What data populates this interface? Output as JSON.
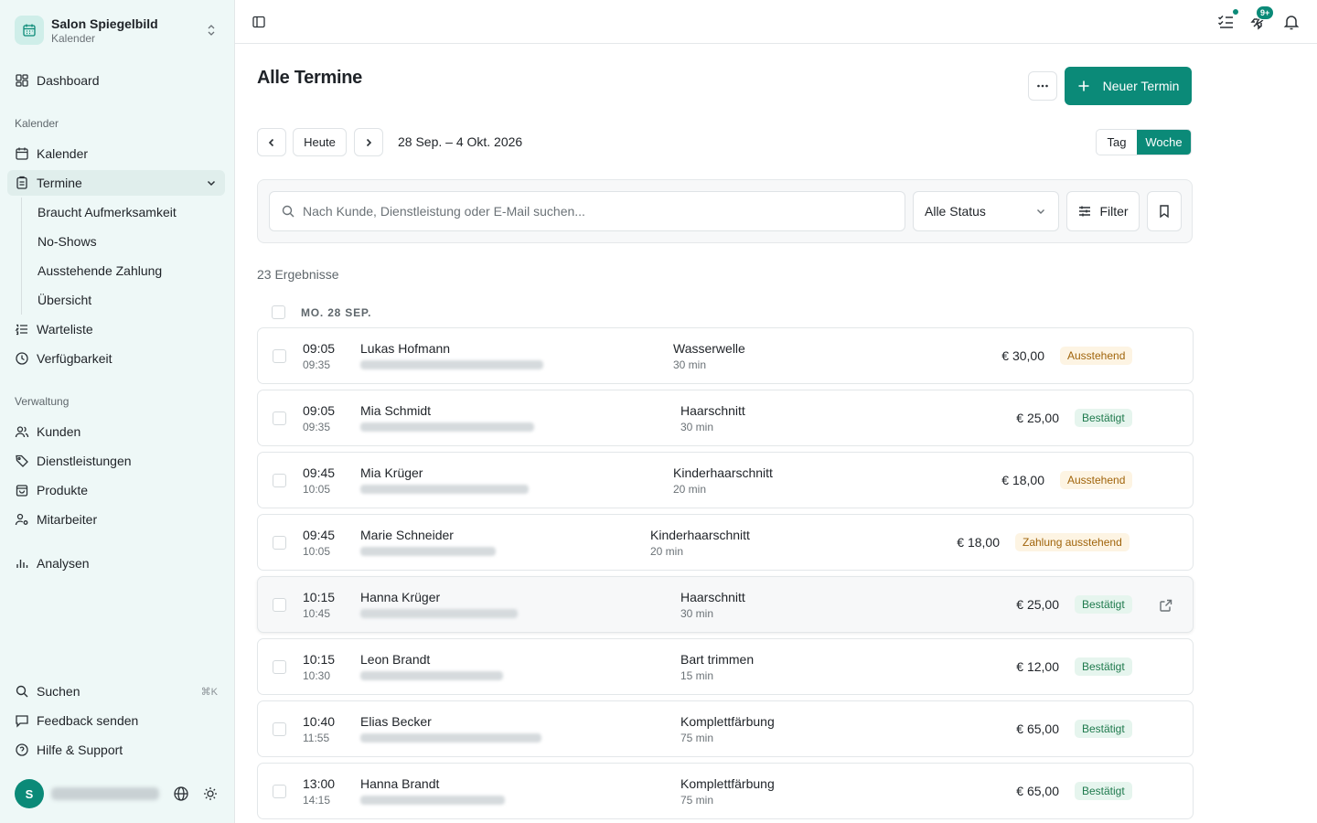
{
  "workspace": {
    "name": "Salon Spiegelbild",
    "sub": "Kalender"
  },
  "nav": {
    "dashboard": "Dashboard",
    "group_calendar": "Kalender",
    "kalender": "Kalender",
    "termine": "Termine",
    "sub": [
      "Braucht Aufmerksamkeit",
      "No-Shows",
      "Ausstehende Zahlung",
      "Übersicht"
    ],
    "warteliste": "Warteliste",
    "verfuegbarkeit": "Verfügbarkeit",
    "group_admin": "Verwaltung",
    "kunden": "Kunden",
    "dienstleistungen": "Dienstleistungen",
    "produkte": "Produkte",
    "mitarbeiter": "Mitarbeiter",
    "analysen": "Analysen",
    "suchen": "Suchen",
    "suchen_kbd": "⌘K",
    "feedback": "Feedback senden",
    "hilfe": "Hilfe & Support"
  },
  "user": {
    "initial": "S"
  },
  "topbar": {
    "badge": "9+"
  },
  "page": {
    "title": "Alle Termine",
    "new_button": "Neuer Termin",
    "today": "Heute",
    "range": "28 Sep. – 4 Okt. 2026",
    "view_day": "Tag",
    "view_week": "Woche",
    "search_placeholder": "Nach Kunde, Dienstleistung oder E-Mail suchen...",
    "status_select": "Alle Status",
    "filter": "Filter",
    "results": "23 Ergebnisse",
    "day_label": "MO. 28 SEP."
  },
  "appointments": [
    {
      "start": "09:05",
      "end": "09:35",
      "customer": "Lukas Hofmann",
      "service": "Wasserwelle",
      "duration": "30 min",
      "price": "€ 30,00",
      "status": "Ausstehend",
      "status_type": "pending"
    },
    {
      "start": "09:05",
      "end": "09:35",
      "customer": "Mia Schmidt",
      "service": "Haarschnitt",
      "duration": "30 min",
      "price": "€ 25,00",
      "status": "Bestätigt",
      "status_type": "ok"
    },
    {
      "start": "09:45",
      "end": "10:05",
      "customer": "Mia Krüger",
      "service": "Kinderhaarschnitt",
      "duration": "20 min",
      "price": "€ 18,00",
      "status": "Ausstehend",
      "status_type": "pending"
    },
    {
      "start": "09:45",
      "end": "10:05",
      "customer": "Marie Schneider",
      "service": "Kinderhaarschnitt",
      "duration": "20 min",
      "price": "€ 18,00",
      "status": "Zahlung ausstehend",
      "status_type": "pending"
    },
    {
      "start": "10:15",
      "end": "10:45",
      "customer": "Hanna Krüger",
      "service": "Haarschnitt",
      "duration": "30 min",
      "price": "€ 25,00",
      "status": "Bestätigt",
      "status_type": "ok"
    },
    {
      "start": "10:15",
      "end": "10:30",
      "customer": "Leon Brandt",
      "service": "Bart trimmen",
      "duration": "15 min",
      "price": "€ 12,00",
      "status": "Bestätigt",
      "status_type": "ok"
    },
    {
      "start": "10:40",
      "end": "11:55",
      "customer": "Elias Becker",
      "service": "Komplettfärbung",
      "duration": "75 min",
      "price": "€ 65,00",
      "status": "Bestätigt",
      "status_type": "ok"
    },
    {
      "start": "13:00",
      "end": "14:15",
      "customer": "Hanna Brandt",
      "service": "Komplettfärbung",
      "duration": "75 min",
      "price": "€ 65,00",
      "status": "Bestätigt",
      "status_type": "ok"
    }
  ]
}
